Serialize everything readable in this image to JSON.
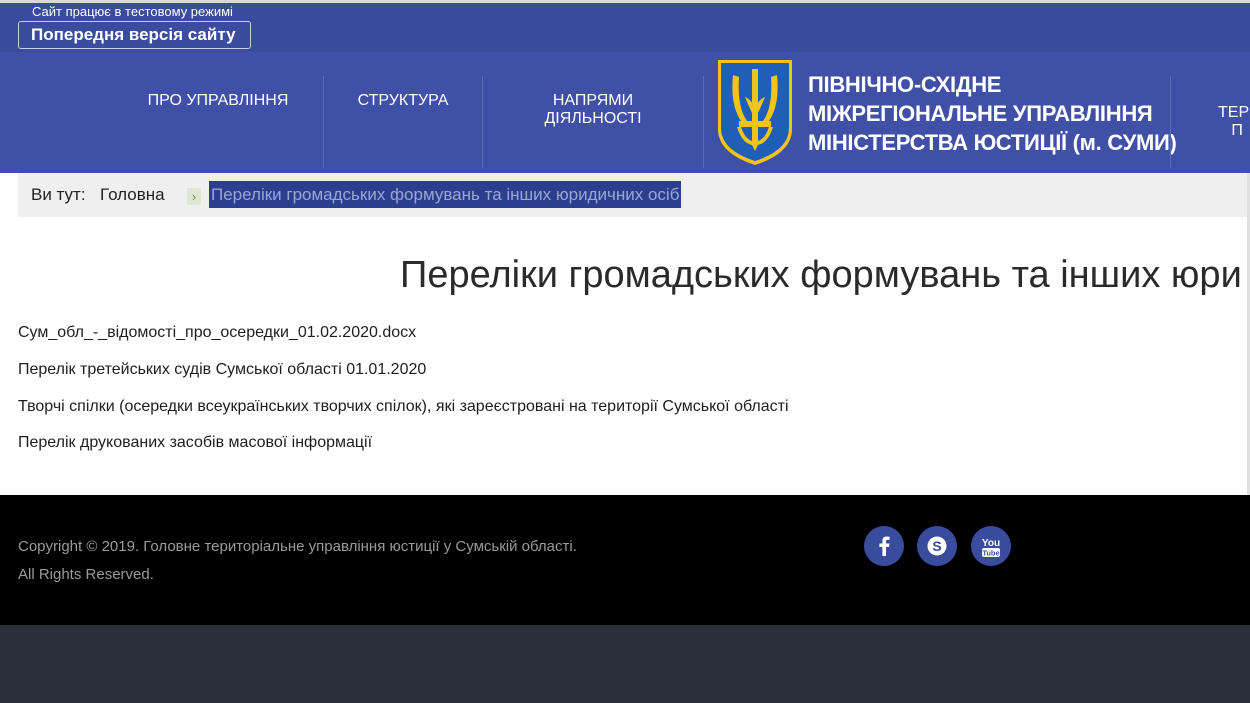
{
  "topbar": {
    "test_notice": "Сайт працює в тестовому режимі",
    "previous_version_label": "Попередня версія сайту"
  },
  "nav": {
    "items": [
      {
        "label": "ПРО УПРАВЛІННЯ"
      },
      {
        "label": "СТРУКТУРА"
      },
      {
        "label": "НАПРЯМИ ДІЯЛЬНОСТІ"
      },
      {
        "label": "ТЕР\nП"
      }
    ],
    "brand_lines": [
      "ПІВНІЧНО-СХІДНЕ",
      "МІЖРЕГІОНАЛЬНЕ УПРАВЛІННЯ",
      "МІНІСТЕРСТВА ЮСТИЦІЇ (м. СУМИ)"
    ],
    "emblem_icon": "trident-coat-of-arms-icon"
  },
  "breadcrumb": {
    "prefix": "Ви тут:",
    "home": "Головна",
    "separator_icon": "chevron-right-icon",
    "current": "Переліки громадських формувань та інших юридичних осіб"
  },
  "main": {
    "title": "Переліки громадських формувань та інших юри",
    "documents": [
      "Сум_обл_-_відомості_про_осередки_01.02.2020.docx",
      "Перелік третейських судів Сумської області 01.01.2020",
      "Творчі спілки (осередки всеукраїнських творчих спілок), які зареєстровані на території Сумської області",
      "Перелік друкованих засобів масової інформації"
    ]
  },
  "footer": {
    "copyright": "Copyright © 2019. Головне територіальне управління юстиції у Сумській області. All Rights Reserved.",
    "social": [
      "facebook-icon",
      "skype-icon",
      "youtube-icon"
    ]
  },
  "colors": {
    "topbar": "#3a4c9e",
    "navbar": "#4050a6",
    "footer": "#000000",
    "bottom_band": "#2a2f3b",
    "emblem_blue": "#1f5fb8",
    "emblem_gold": "#f2c417"
  }
}
